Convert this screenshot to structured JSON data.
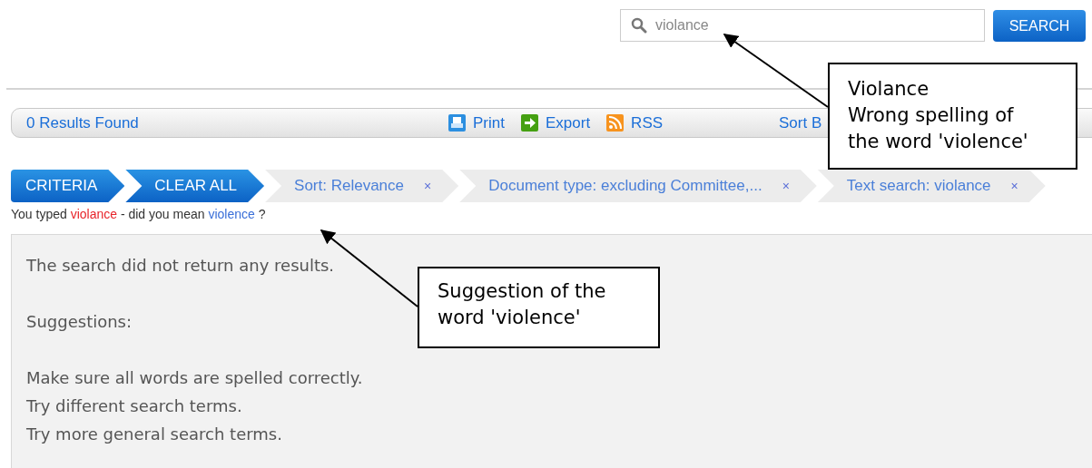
{
  "search": {
    "value": "violance",
    "button": "SEARCH"
  },
  "toolbar": {
    "results": "0 Results Found",
    "actions": [
      {
        "kind": "print",
        "label": "Print"
      },
      {
        "kind": "export",
        "label": "Export"
      },
      {
        "kind": "rss",
        "label": "RSS"
      }
    ],
    "sort": "Sort B"
  },
  "criteria": [
    {
      "kind": "button",
      "label": "CRITERIA"
    },
    {
      "kind": "button",
      "label": "CLEAR ALL"
    },
    {
      "kind": "filter",
      "label": "Sort: Relevance",
      "remove": "×"
    },
    {
      "kind": "filter",
      "label": "Document type: excluding Committee,...",
      "remove": "×"
    },
    {
      "kind": "filter",
      "label": "Text search: violance",
      "remove": "×"
    }
  ],
  "did_you_mean": {
    "prefix": "You typed",
    "typed": "violance",
    "middle": "- did you mean",
    "suggestion": "violence",
    "suffix": "?"
  },
  "message": {
    "intro": "The search did not return any results.",
    "heading": "Suggestions:",
    "tips": [
      "Make sure all words are spelled correctly.",
      "Try different search terms.",
      "Try more general search terms."
    ]
  },
  "annotations": [
    {
      "lines": [
        "Violance",
        "Wrong spelling of",
        "the word 'violence'"
      ]
    },
    {
      "lines": [
        "Suggestion of the",
        "word 'violence'"
      ]
    }
  ]
}
